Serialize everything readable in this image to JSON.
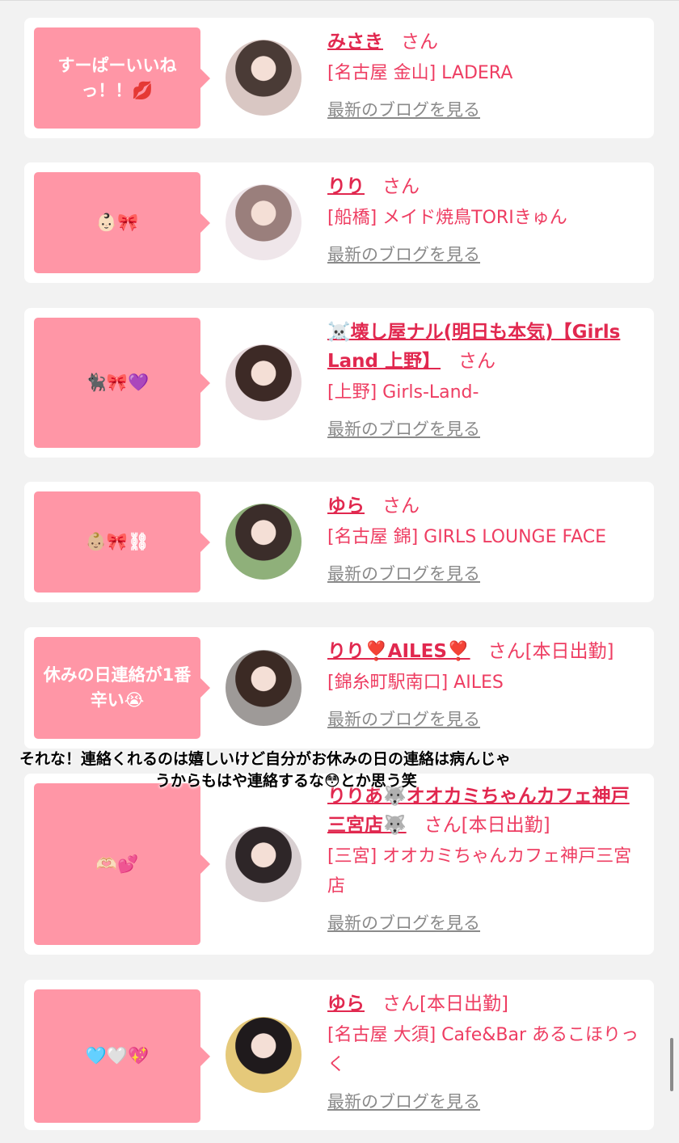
{
  "overlay_comment": {
    "line1": "それな！連絡くれるのは嬉しいけど自分がお休みの日の連絡は病んじゃ",
    "line2": "うからもはや連絡するな😳とか思う笑"
  },
  "cards": [
    {
      "comment": "すーぱーいいねっ！！💋",
      "name": "みさき",
      "honorific": "さん",
      "status": "",
      "shop": "[名古屋 金山] LADERA",
      "blog_link": "最新のブログを見る",
      "avatar_colors": [
        "#d9c7c3",
        "#4a3b36"
      ]
    },
    {
      "comment": "👶🏻🎀",
      "name": "りり",
      "honorific": "さん",
      "status": "",
      "shop": "[船橋] メイド焼鳥TORIきゅん",
      "blog_link": "最新のブログを見る",
      "avatar_colors": [
        "#efe6ea",
        "#9a7f7c"
      ]
    },
    {
      "comment": "🐈‍⬛🎀💜",
      "name": "☠️壊し屋ナル(明日も本気)【Girls Land 上野】",
      "honorific": "さん",
      "status": "",
      "shop": "[上野] Girls-Land-",
      "blog_link": "最新のブログを見る",
      "avatar_colors": [
        "#e7d9dc",
        "#3d2a26"
      ]
    },
    {
      "comment": "👶🏼🎀⛓",
      "name": "ゆら",
      "honorific": "さん",
      "status": "",
      "shop": "[名古屋 錦] GIRLS LOUNGE FACE",
      "blog_link": "最新のブログを見る",
      "avatar_colors": [
        "#8fb07a",
        "#3b2d2a"
      ]
    },
    {
      "comment": "休みの日連絡が1番辛い😭",
      "name": "りり❣️AILES❣️",
      "honorific": "さん",
      "status": "[本日出勤]",
      "shop": "[錦糸町駅南口] AILES",
      "blog_link": "最新のブログを見る",
      "avatar_colors": [
        "#9e9a98",
        "#3b2a24"
      ]
    },
    {
      "comment": "🫶🏻💕",
      "name": "りりあ🐺オオカミちゃんカフェ神戸三宮店🐺",
      "honorific": "さん",
      "status": "[本日出勤]",
      "shop": "[三宮] オオカミちゃんカフェ神戸三宮店",
      "blog_link": "最新のブログを見る",
      "avatar_colors": [
        "#d8cfd1",
        "#2e2628"
      ]
    },
    {
      "comment": "🩵🤍💖",
      "name": "ゆら",
      "honorific": "さん",
      "status": "[本日出勤]",
      "shop": "[名古屋 大須] Cafe&Bar あるこほりっく",
      "blog_link": "最新のブログを見る",
      "avatar_colors": [
        "#e5c97a",
        "#1f1a1c"
      ]
    }
  ]
}
